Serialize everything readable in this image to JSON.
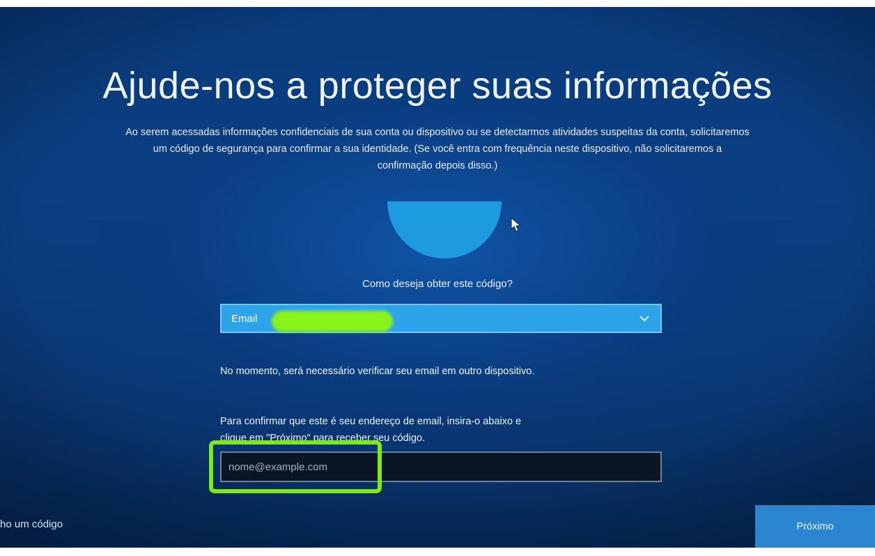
{
  "page": {
    "title": "Ajude-nos a proteger suas informações",
    "description_lines": [
      "Ao serem acessadas informações confidenciais de sua conta ou dispositivo ou se detectarmos atividades suspeitas da conta, solicitaremos",
      "um código de segurança para confirmar a sua identidade. (Se você entra com frequência neste dispositivo, não solicitaremos a",
      "confirmação depois disso.)"
    ]
  },
  "form": {
    "question": "Como deseja obter este código?",
    "method_select": {
      "value": "Email",
      "icon": "chevron-down-icon"
    },
    "note": "No momento, será necessário verificar seu email em outro dispositivo.",
    "instructions_lines": [
      "Para confirmar que este é seu endereço de email, insira-o abaixo e",
      "clique em \"Próximo\" para receber seu código."
    ],
    "email_input": {
      "placeholder": "nome@example.com",
      "value": ""
    }
  },
  "footer": {
    "code_link": "ho um código",
    "next_button": "Próximo"
  },
  "colors": {
    "background": "#0b3f82",
    "accent": "#2da3ea",
    "hero": "#1e9be0",
    "highlight": "#7de81c",
    "button": "#2c86cf"
  }
}
